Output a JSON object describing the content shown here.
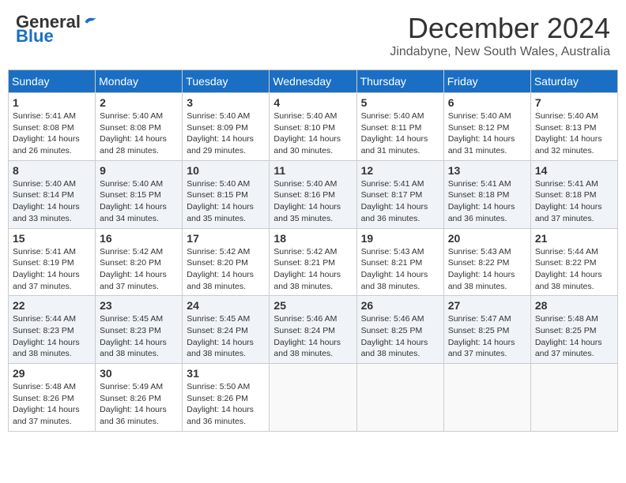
{
  "header": {
    "logo_general": "General",
    "logo_blue": "Blue",
    "title": "December 2024",
    "subtitle": "Jindabyne, New South Wales, Australia"
  },
  "calendar": {
    "days_of_week": [
      "Sunday",
      "Monday",
      "Tuesday",
      "Wednesday",
      "Thursday",
      "Friday",
      "Saturday"
    ],
    "weeks": [
      [
        {
          "day": "1",
          "info": "Sunrise: 5:41 AM\nSunset: 8:08 PM\nDaylight: 14 hours\nand 26 minutes."
        },
        {
          "day": "2",
          "info": "Sunrise: 5:40 AM\nSunset: 8:08 PM\nDaylight: 14 hours\nand 28 minutes."
        },
        {
          "day": "3",
          "info": "Sunrise: 5:40 AM\nSunset: 8:09 PM\nDaylight: 14 hours\nand 29 minutes."
        },
        {
          "day": "4",
          "info": "Sunrise: 5:40 AM\nSunset: 8:10 PM\nDaylight: 14 hours\nand 30 minutes."
        },
        {
          "day": "5",
          "info": "Sunrise: 5:40 AM\nSunset: 8:11 PM\nDaylight: 14 hours\nand 31 minutes."
        },
        {
          "day": "6",
          "info": "Sunrise: 5:40 AM\nSunset: 8:12 PM\nDaylight: 14 hours\nand 31 minutes."
        },
        {
          "day": "7",
          "info": "Sunrise: 5:40 AM\nSunset: 8:13 PM\nDaylight: 14 hours\nand 32 minutes."
        }
      ],
      [
        {
          "day": "8",
          "info": "Sunrise: 5:40 AM\nSunset: 8:14 PM\nDaylight: 14 hours\nand 33 minutes."
        },
        {
          "day": "9",
          "info": "Sunrise: 5:40 AM\nSunset: 8:15 PM\nDaylight: 14 hours\nand 34 minutes."
        },
        {
          "day": "10",
          "info": "Sunrise: 5:40 AM\nSunset: 8:15 PM\nDaylight: 14 hours\nand 35 minutes."
        },
        {
          "day": "11",
          "info": "Sunrise: 5:40 AM\nSunset: 8:16 PM\nDaylight: 14 hours\nand 35 minutes."
        },
        {
          "day": "12",
          "info": "Sunrise: 5:41 AM\nSunset: 8:17 PM\nDaylight: 14 hours\nand 36 minutes."
        },
        {
          "day": "13",
          "info": "Sunrise: 5:41 AM\nSunset: 8:18 PM\nDaylight: 14 hours\nand 36 minutes."
        },
        {
          "day": "14",
          "info": "Sunrise: 5:41 AM\nSunset: 8:18 PM\nDaylight: 14 hours\nand 37 minutes."
        }
      ],
      [
        {
          "day": "15",
          "info": "Sunrise: 5:41 AM\nSunset: 8:19 PM\nDaylight: 14 hours\nand 37 minutes."
        },
        {
          "day": "16",
          "info": "Sunrise: 5:42 AM\nSunset: 8:20 PM\nDaylight: 14 hours\nand 37 minutes."
        },
        {
          "day": "17",
          "info": "Sunrise: 5:42 AM\nSunset: 8:20 PM\nDaylight: 14 hours\nand 38 minutes."
        },
        {
          "day": "18",
          "info": "Sunrise: 5:42 AM\nSunset: 8:21 PM\nDaylight: 14 hours\nand 38 minutes."
        },
        {
          "day": "19",
          "info": "Sunrise: 5:43 AM\nSunset: 8:21 PM\nDaylight: 14 hours\nand 38 minutes."
        },
        {
          "day": "20",
          "info": "Sunrise: 5:43 AM\nSunset: 8:22 PM\nDaylight: 14 hours\nand 38 minutes."
        },
        {
          "day": "21",
          "info": "Sunrise: 5:44 AM\nSunset: 8:22 PM\nDaylight: 14 hours\nand 38 minutes."
        }
      ],
      [
        {
          "day": "22",
          "info": "Sunrise: 5:44 AM\nSunset: 8:23 PM\nDaylight: 14 hours\nand 38 minutes."
        },
        {
          "day": "23",
          "info": "Sunrise: 5:45 AM\nSunset: 8:23 PM\nDaylight: 14 hours\nand 38 minutes."
        },
        {
          "day": "24",
          "info": "Sunrise: 5:45 AM\nSunset: 8:24 PM\nDaylight: 14 hours\nand 38 minutes."
        },
        {
          "day": "25",
          "info": "Sunrise: 5:46 AM\nSunset: 8:24 PM\nDaylight: 14 hours\nand 38 minutes."
        },
        {
          "day": "26",
          "info": "Sunrise: 5:46 AM\nSunset: 8:25 PM\nDaylight: 14 hours\nand 38 minutes."
        },
        {
          "day": "27",
          "info": "Sunrise: 5:47 AM\nSunset: 8:25 PM\nDaylight: 14 hours\nand 37 minutes."
        },
        {
          "day": "28",
          "info": "Sunrise: 5:48 AM\nSunset: 8:25 PM\nDaylight: 14 hours\nand 37 minutes."
        }
      ],
      [
        {
          "day": "29",
          "info": "Sunrise: 5:48 AM\nSunset: 8:26 PM\nDaylight: 14 hours\nand 37 minutes."
        },
        {
          "day": "30",
          "info": "Sunrise: 5:49 AM\nSunset: 8:26 PM\nDaylight: 14 hours\nand 36 minutes."
        },
        {
          "day": "31",
          "info": "Sunrise: 5:50 AM\nSunset: 8:26 PM\nDaylight: 14 hours\nand 36 minutes."
        },
        null,
        null,
        null,
        null
      ]
    ]
  }
}
